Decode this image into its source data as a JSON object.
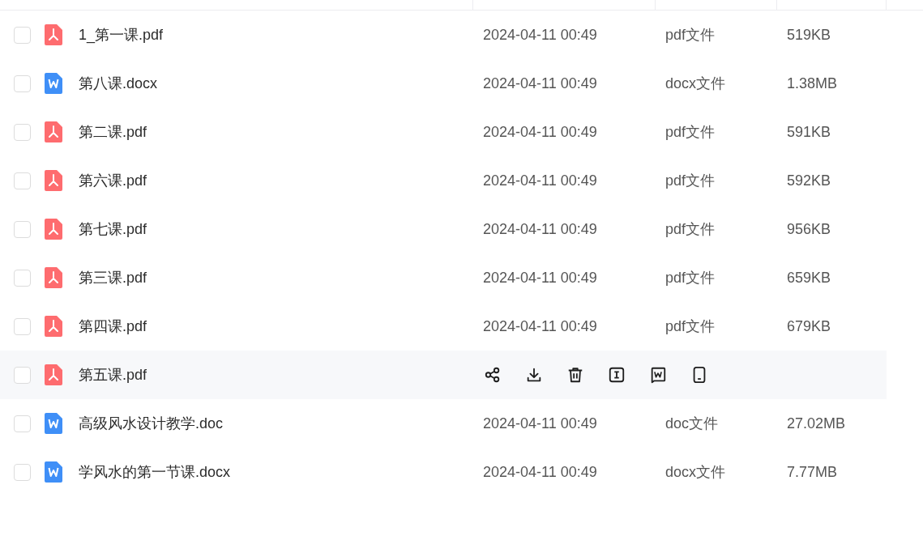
{
  "files": [
    {
      "name": "1_第一课.pdf",
      "kind": "pdf",
      "checked": false,
      "hovered": false,
      "date": "2024-04-11 00:49",
      "type": "pdf文件",
      "size": "519KB"
    },
    {
      "name": "第八课.docx",
      "kind": "word",
      "checked": false,
      "hovered": false,
      "date": "2024-04-11 00:49",
      "type": "docx文件",
      "size": "1.38MB"
    },
    {
      "name": "第二课.pdf",
      "kind": "pdf",
      "checked": false,
      "hovered": false,
      "date": "2024-04-11 00:49",
      "type": "pdf文件",
      "size": "591KB"
    },
    {
      "name": "第六课.pdf",
      "kind": "pdf",
      "checked": false,
      "hovered": false,
      "date": "2024-04-11 00:49",
      "type": "pdf文件",
      "size": "592KB"
    },
    {
      "name": "第七课.pdf",
      "kind": "pdf",
      "checked": false,
      "hovered": false,
      "date": "2024-04-11 00:49",
      "type": "pdf文件",
      "size": "956KB"
    },
    {
      "name": "第三课.pdf",
      "kind": "pdf",
      "checked": false,
      "hovered": false,
      "date": "2024-04-11 00:49",
      "type": "pdf文件",
      "size": "659KB"
    },
    {
      "name": "第四课.pdf",
      "kind": "pdf",
      "checked": false,
      "hovered": false,
      "date": "2024-04-11 00:49",
      "type": "pdf文件",
      "size": "679KB"
    },
    {
      "name": "第五课.pdf",
      "kind": "pdf",
      "checked": false,
      "hovered": true
    },
    {
      "name": "高级风水设计教学.doc",
      "kind": "word",
      "checked": false,
      "hovered": false,
      "date": "2024-04-11 00:49",
      "type": "doc文件",
      "size": "27.02MB"
    },
    {
      "name": "学风水的第一节课.docx",
      "kind": "word",
      "checked": false,
      "hovered": false,
      "date": "2024-04-11 00:49",
      "type": "docx文件",
      "size": "7.77MB"
    }
  ]
}
